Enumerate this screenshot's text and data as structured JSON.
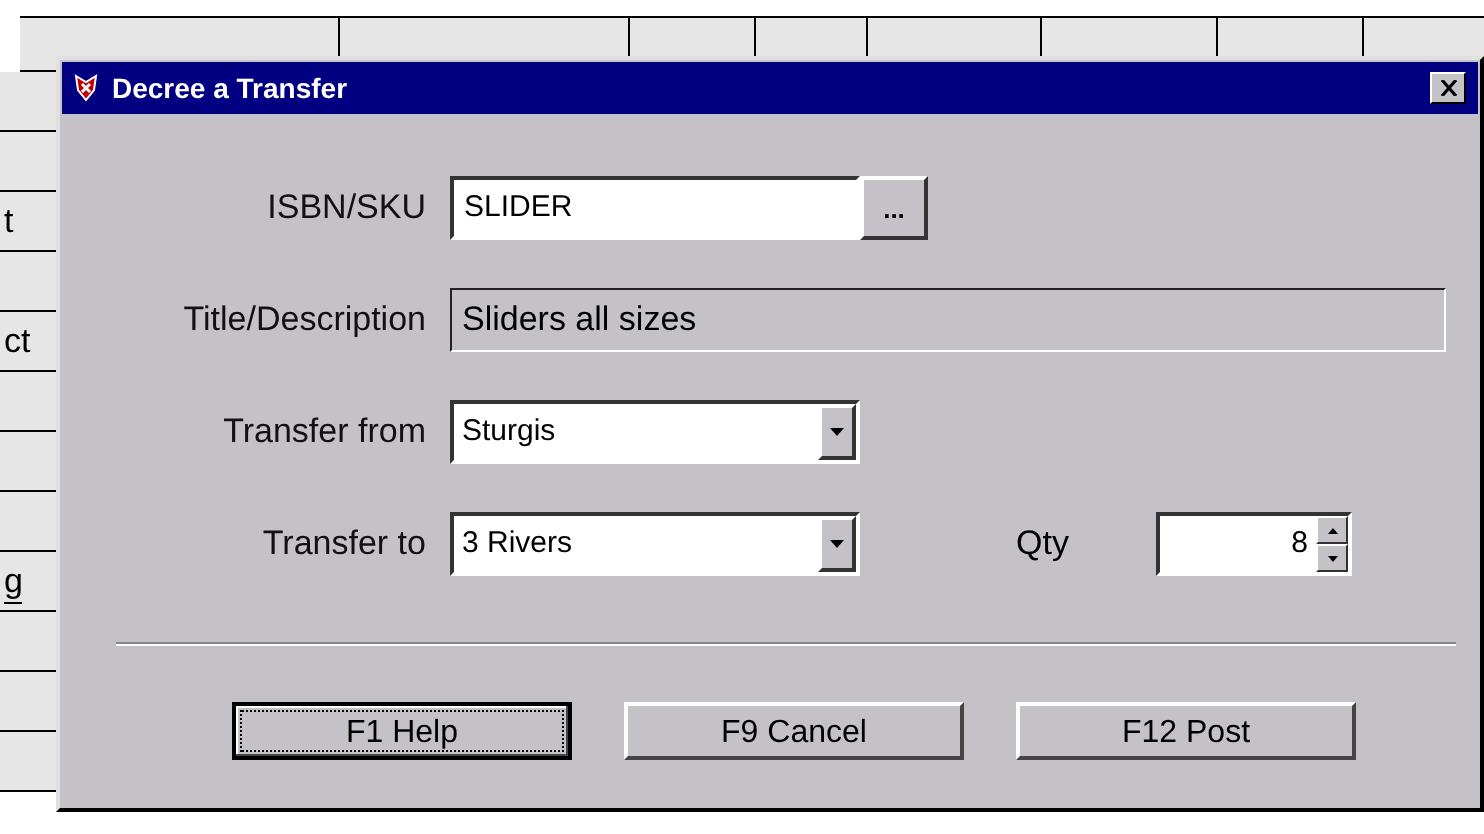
{
  "window": {
    "title": "Decree a Transfer"
  },
  "background_grid": {
    "row_fragments": [
      {
        "text": "t",
        "link": false
      },
      {
        "text": "ct",
        "link": false
      },
      {
        "text": "g",
        "link": true
      }
    ]
  },
  "fields": [
    {
      "kind": "text",
      "label": "ISBN/SKU",
      "value": "SLIDER",
      "browse_button": "..."
    },
    {
      "kind": "readonly",
      "label": "Title/Description",
      "value": "Sliders all sizes"
    },
    {
      "kind": "dropdown",
      "label": "Transfer from",
      "value": "Sturgis"
    },
    {
      "kind": "dropdown",
      "label": "Transfer to",
      "value": "3 Rivers",
      "spinner": {
        "label": "Qty",
        "value": "8"
      }
    }
  ],
  "buttons": [
    {
      "label": "F1 Help",
      "focused": true
    },
    {
      "label": "F9 Cancel",
      "focused": false
    },
    {
      "label": "F12 Post",
      "focused": false
    }
  ]
}
